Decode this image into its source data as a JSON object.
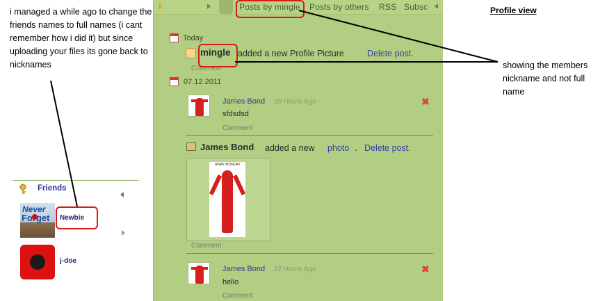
{
  "annotations": {
    "left_note": "i managed a while ago to change the friends names to full names (i cant remember how i did it) but since  uploading your files its gone back to nicknames",
    "profile_view": "Profile view",
    "right_note": "showing the members nickname and not full name"
  },
  "friends": {
    "title": "Friends",
    "items": [
      {
        "name": "Newbie",
        "avatar_text_1": "Never",
        "avatar_text_2": "Forget"
      },
      {
        "name": "j-doe"
      }
    ]
  },
  "tabs": [
    "Posts by mingle",
    "Posts by others",
    "RSS",
    "Subsc"
  ],
  "feed": {
    "group1_date": "Today",
    "entry1": {
      "user": "mingle",
      "action": "added a new Profile Picture",
      "delete": "Delete post.",
      "comment": "Comment"
    },
    "group2_date": "07.12.2011",
    "post1": {
      "author": "James Bond",
      "time": "20 Hours Ago",
      "body": "sfdsdsd",
      "comment": "Comment"
    },
    "entry2": {
      "user": "James Bond",
      "action": "added a new",
      "photo_link": "photo",
      "delete": "Delete post.",
      "comment": "Comment",
      "photo_caption": "AWAY MONDAY"
    },
    "post2": {
      "author": "James Bond",
      "time": "22 Hours Ago",
      "body": "hello",
      "comment": "Comment"
    }
  },
  "colors": {
    "panel_green": "#b2ce82",
    "highlight_red": "#d71a1a",
    "link_blue": "#3340a8"
  }
}
